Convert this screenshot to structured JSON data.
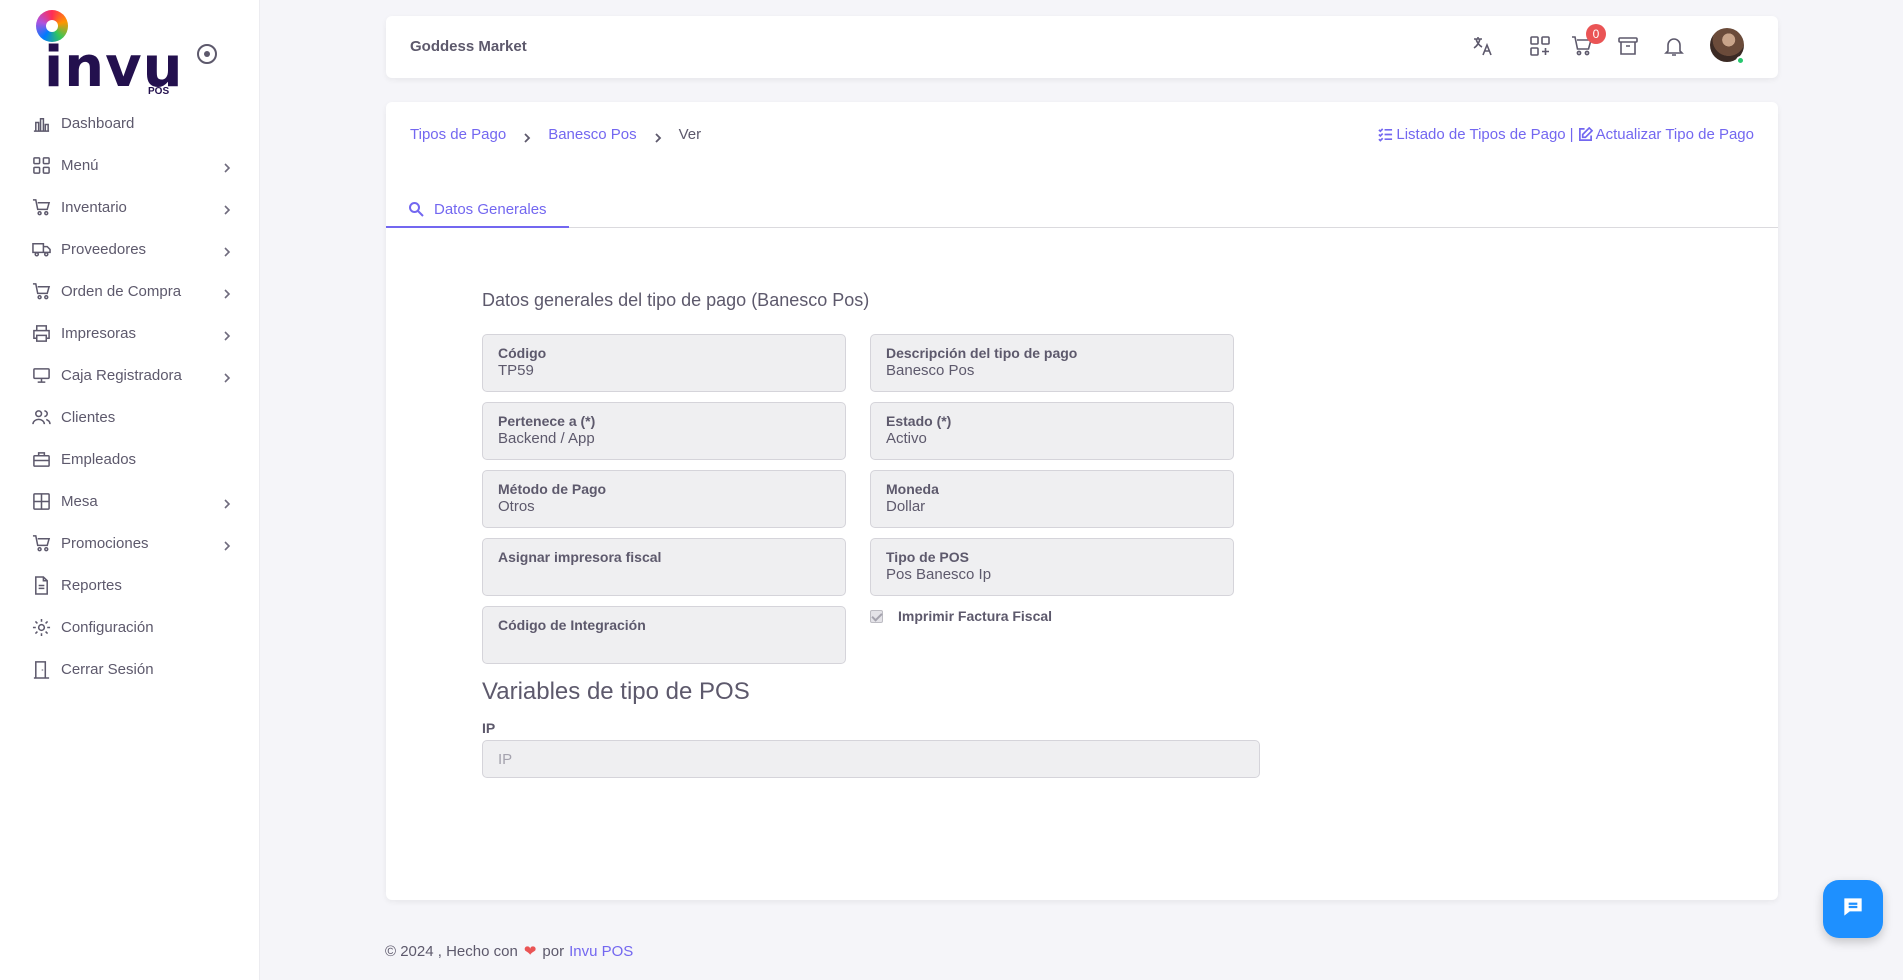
{
  "app": {
    "logo_text": "invu",
    "logo_sub": "POS"
  },
  "sidebar": {
    "items": [
      {
        "label": "Dashboard",
        "icon": "bar-chart-icon",
        "has_children": false
      },
      {
        "label": "Menú",
        "icon": "grid-icon",
        "has_children": true
      },
      {
        "label": "Inventario",
        "icon": "cart-icon",
        "has_children": true
      },
      {
        "label": "Proveedores",
        "icon": "truck-icon",
        "has_children": true
      },
      {
        "label": "Orden de Compra",
        "icon": "shopping-cart-icon",
        "has_children": true
      },
      {
        "label": "Impresoras",
        "icon": "printer-icon",
        "has_children": true
      },
      {
        "label": "Caja Registradora",
        "icon": "cash-register-icon",
        "has_children": true
      },
      {
        "label": "Clientes",
        "icon": "users-icon",
        "has_children": false
      },
      {
        "label": "Empleados",
        "icon": "briefcase-icon",
        "has_children": false
      },
      {
        "label": "Mesa",
        "icon": "table-icon",
        "has_children": true
      },
      {
        "label": "Promociones",
        "icon": "shopping-cart-icon",
        "has_children": true
      },
      {
        "label": "Reportes",
        "icon": "file-icon",
        "has_children": false
      },
      {
        "label": "Configuración",
        "icon": "gear-icon",
        "has_children": false
      },
      {
        "label": "Cerrar Sesión",
        "icon": "door-icon",
        "has_children": false
      }
    ]
  },
  "navbar": {
    "store_name": "Goddess Market",
    "cart_count": "0"
  },
  "breadcrumb": {
    "items": [
      "Tipos de Pago",
      "Banesco Pos"
    ],
    "current": "Ver"
  },
  "top_links": {
    "list": "Listado de Tipos de Pago",
    "separator": "|",
    "update": "Actualizar Tipo de Pago"
  },
  "tabs": {
    "active": "Datos Generales"
  },
  "form": {
    "title": "Datos generales del tipo de pago (Banesco Pos)",
    "fields": {
      "codigo": {
        "label": "Código",
        "value": "TP59"
      },
      "descripcion": {
        "label": "Descripción del tipo de pago",
        "value": "Banesco Pos"
      },
      "pertenece": {
        "label": "Pertenece a (*)",
        "value": "Backend / App"
      },
      "estado": {
        "label": "Estado (*)",
        "value": "Activo"
      },
      "metodo": {
        "label": "Método de Pago",
        "value": "Otros"
      },
      "moneda": {
        "label": "Moneda",
        "value": "Dollar"
      },
      "impresora": {
        "label": "Asignar impresora fiscal",
        "value": ""
      },
      "tipo_pos": {
        "label": "Tipo de POS",
        "value": "Pos Banesco Ip"
      },
      "integracion": {
        "label": "Código de Integración",
        "value": ""
      }
    },
    "checkbox_label": "Imprimir Factura Fiscal",
    "checkbox_checked": true,
    "variables_title": "Variables de tipo de POS",
    "ip_label": "IP",
    "ip_placeholder": "IP"
  },
  "footer": {
    "prefix": "© 2024 , Hecho con",
    "by": "por",
    "link": "Invu POS"
  },
  "colors": {
    "accent": "#7367f0",
    "badge": "#ea5455",
    "chat": "#1e90ff"
  }
}
